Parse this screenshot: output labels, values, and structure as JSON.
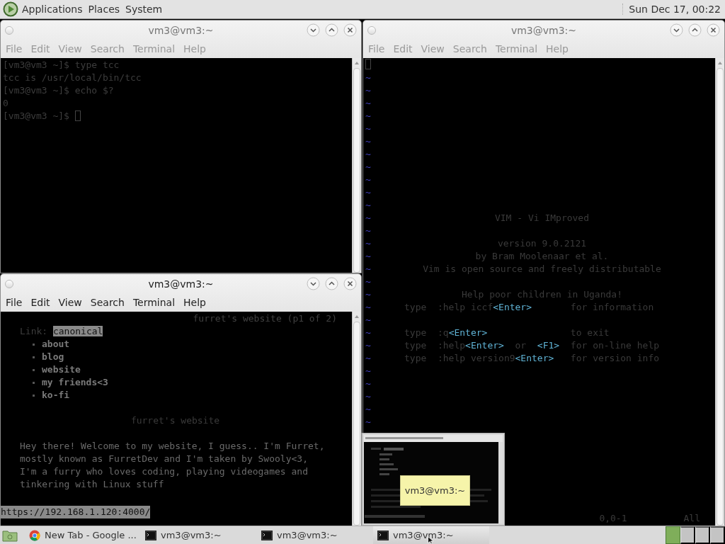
{
  "top_panel": {
    "menus": [
      "Applications",
      "Places",
      "System"
    ],
    "clock": "Sun Dec 17, 00:22"
  },
  "windows": [
    {
      "kind": "shell",
      "title": "vm3@vm3:~",
      "active": false,
      "menu": [
        "File",
        "Edit",
        "View",
        "Search",
        "Terminal",
        "Help"
      ],
      "cursor": true,
      "lines": [
        "[vm3@vm3 ~]$ type tcc",
        "tcc is /usr/local/bin/tcc",
        "[vm3@vm3 ~]$ echo $?",
        "0",
        "[vm3@vm3 ~]$"
      ]
    },
    {
      "kind": "vim",
      "title": "vm3@vm3:~",
      "active": false,
      "menu": [
        "File",
        "Edit",
        "View",
        "Search",
        "Terminal",
        "Help"
      ],
      "cursor": true,
      "rows": [
        {
          "marker": "~"
        },
        {
          "marker": "~"
        },
        {
          "marker": "~"
        },
        {
          "marker": "~"
        },
        {
          "marker": "~"
        },
        {
          "marker": "~"
        },
        {
          "marker": "~"
        },
        {
          "marker": "~"
        },
        {
          "marker": "~"
        },
        {
          "marker": "~"
        },
        {
          "marker": "~"
        },
        {
          "marker": "~",
          "kind": "centered",
          "segments": [
            {
              "text": "VIM - Vi IMproved",
              "kind": "plain"
            }
          ]
        },
        {
          "marker": "~"
        },
        {
          "marker": "~",
          "kind": "centered",
          "segments": [
            {
              "text": "version 9.0.2121",
              "kind": "plain"
            }
          ]
        },
        {
          "marker": "~",
          "kind": "centered",
          "segments": [
            {
              "text": "by Bram Moolenaar et al.",
              "kind": "plain"
            }
          ]
        },
        {
          "marker": "~",
          "kind": "centered",
          "segments": [
            {
              "text": "Vim is open source and freely distributable",
              "kind": "plain"
            }
          ]
        },
        {
          "marker": "~"
        },
        {
          "marker": "~",
          "kind": "centered",
          "segments": [
            {
              "text": "Help poor children in Uganda!",
              "kind": "plain"
            }
          ]
        },
        {
          "marker": "~",
          "kind": "help",
          "segments": [
            {
              "text": "type  :help iccf",
              "kind": "plain"
            },
            {
              "text": "<Enter>",
              "kind": "key"
            },
            {
              "text": "       for information",
              "kind": "plain"
            }
          ]
        },
        {
          "marker": "~"
        },
        {
          "marker": "~",
          "kind": "help",
          "segments": [
            {
              "text": "type  :q",
              "kind": "plain"
            },
            {
              "text": "<Enter>",
              "kind": "key"
            },
            {
              "text": "               to exit",
              "kind": "plain"
            }
          ]
        },
        {
          "marker": "~",
          "kind": "help",
          "segments": [
            {
              "text": "type  :help",
              "kind": "plain"
            },
            {
              "text": "<Enter>",
              "kind": "key"
            },
            {
              "text": "  or  ",
              "kind": "plain"
            },
            {
              "text": "<F1>",
              "kind": "key"
            },
            {
              "text": "  for on-line help",
              "kind": "plain"
            }
          ]
        },
        {
          "marker": "~",
          "kind": "help",
          "segments": [
            {
              "text": "type  :help version9",
              "kind": "plain"
            },
            {
              "text": "<Enter>",
              "kind": "key"
            },
            {
              "text": "   for version info",
              "kind": "plain"
            }
          ]
        },
        {
          "marker": "~"
        },
        {
          "marker": "~"
        },
        {
          "marker": "~"
        },
        {
          "marker": "~"
        },
        {
          "marker": "~"
        }
      ],
      "status": {
        "position": "0,0-1",
        "scroll": "All"
      }
    },
    {
      "kind": "lynx",
      "title": "vm3@vm3:~",
      "active": true,
      "menu": [
        "File",
        "Edit",
        "View",
        "Search",
        "Terminal",
        "Help"
      ],
      "rows": [
        {
          "kind": "header",
          "text": "furret's website (p1 of 2)"
        },
        {
          "kind": "link",
          "label": "Link:",
          "link": "canonical",
          "selected": true
        },
        {
          "kind": "bullet",
          "text": "about"
        },
        {
          "kind": "bullet",
          "text": "blog"
        },
        {
          "kind": "bullet",
          "text": "website"
        },
        {
          "kind": "bullet",
          "text": "my friends<3"
        },
        {
          "kind": "bullet",
          "text": "ko-fi"
        },
        {
          "kind": "heading",
          "text": "furret's website"
        },
        {
          "kind": "text",
          "text": "Hey there! Welcome to my website, I guess.. I'm Furret,"
        },
        {
          "kind": "text",
          "text": "mostly known as FurretDev and I'm taken by Swooly<3,"
        },
        {
          "kind": "text",
          "text": "I'm a furry who loves coding, playing videogames and"
        },
        {
          "kind": "text",
          "text": "tinkering with Linux stuff"
        }
      ],
      "status_url": "https://192.168.1.120:4000/"
    }
  ],
  "preview": {
    "tooltip": "vm3@vm3:~"
  },
  "taskbar": {
    "tasks": [
      {
        "kind": "browser",
        "label": "New Tab - Google ...",
        "selected": false
      },
      {
        "kind": "terminal",
        "label": "vm3@vm3:~",
        "selected": false
      },
      {
        "kind": "terminal",
        "label": "vm3@vm3:~",
        "selected": false
      },
      {
        "kind": "terminal",
        "label": "vm3@vm3:~",
        "selected": true
      }
    ],
    "workspaces": [
      {
        "selected": true
      },
      {
        "selected": false
      },
      {
        "selected": false
      },
      {
        "selected": false
      }
    ]
  }
}
